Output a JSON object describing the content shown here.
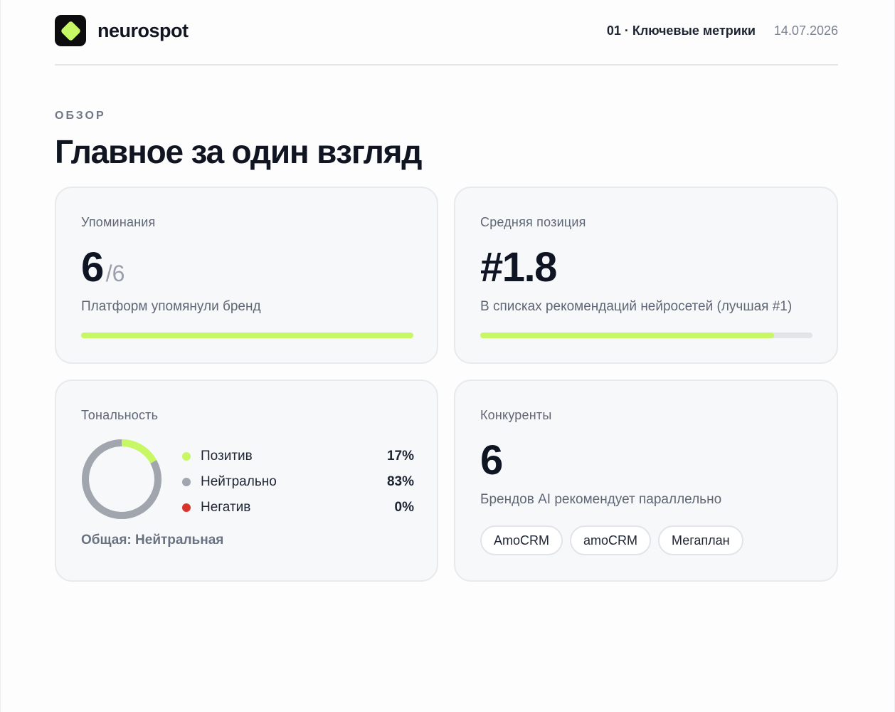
{
  "header": {
    "brand": "neurospot",
    "section": "01 · Ключевые метрики",
    "date": "14.07.2026"
  },
  "overview": {
    "eyebrow": "ОБЗОР",
    "title": "Главное за один взгляд"
  },
  "mentions": {
    "label": "Упоминания",
    "value": "6",
    "total": "/6",
    "description": "Платформ упомянули бренд",
    "progress": 1.0
  },
  "position": {
    "label": "Средняя позиция",
    "value": "#1.8",
    "description": "В списках рекомендаций нейросетей (лучшая #1)",
    "progress": 0.885
  },
  "sentiment": {
    "label": "Тональность",
    "items": [
      {
        "name": "Позитив",
        "value": "17%",
        "percent": 17,
        "color": "#c8f766"
      },
      {
        "name": "Нейтрально",
        "value": "83%",
        "percent": 83,
        "color": "#a0a5ae"
      },
      {
        "name": "Негатив",
        "value": "0%",
        "percent": 0,
        "color": "#d8342c"
      }
    ],
    "overall": "Общая: Нейтральная"
  },
  "competitors": {
    "label": "Конкуренты",
    "value": "6",
    "description": "Брендов AI рекомендует параллельно",
    "chips": [
      "AmoCRM",
      "amoCRM",
      "Мегаплан"
    ]
  },
  "colors": {
    "accent": "#c8f766",
    "track": "#e3e4e7"
  }
}
